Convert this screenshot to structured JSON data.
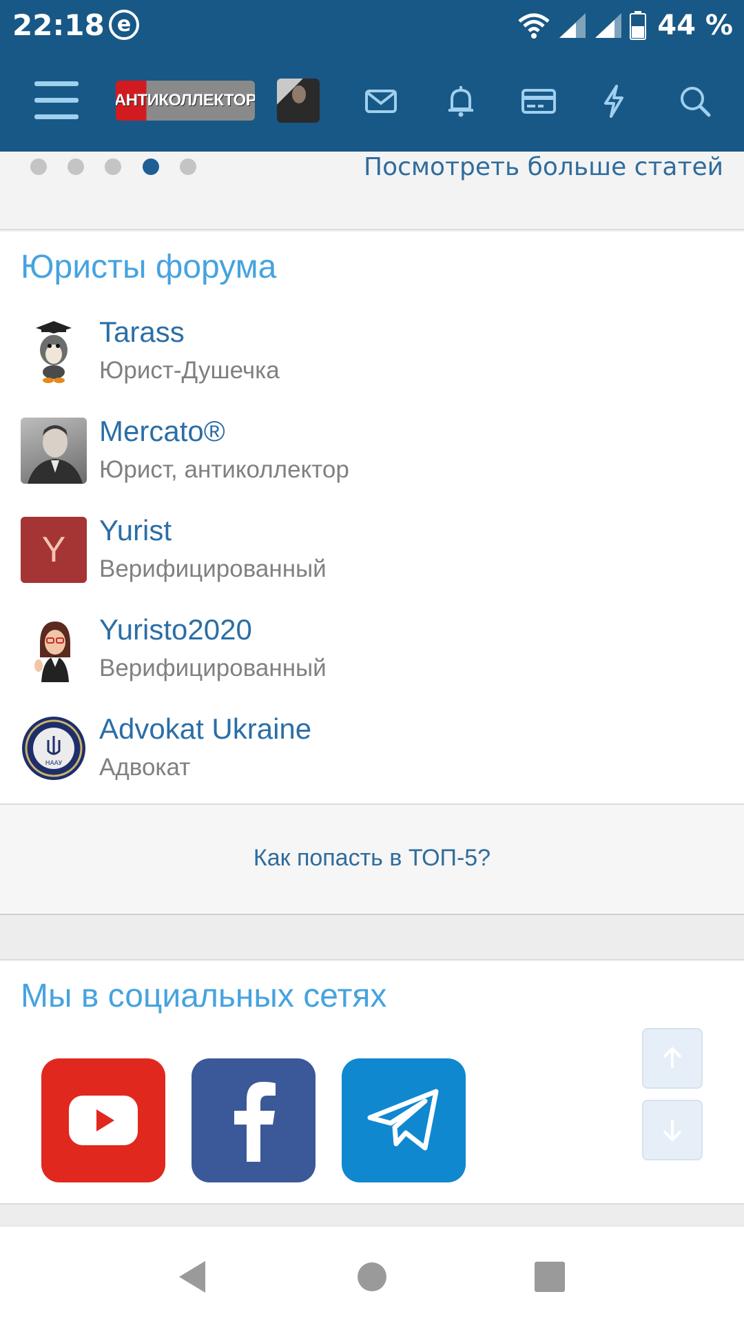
{
  "status_bar": {
    "time": "22:18",
    "app_indicator": "e",
    "battery_percent": "44 %",
    "icons": [
      "wifi-icon",
      "signal-icon",
      "signal-icon",
      "battery-icon"
    ]
  },
  "header": {
    "logo_text": "АНТИКОЛЛЕКТОР",
    "icons": [
      "menu-icon",
      "mail-icon",
      "bell-icon",
      "card-icon",
      "lightning-icon",
      "search-icon"
    ]
  },
  "carousel": {
    "dot_count": 5,
    "active_dot_index": 3,
    "more_link": "Посмотреть больше статей"
  },
  "lawyers": {
    "title": "Юристы форума",
    "items": [
      {
        "name": "Tarass",
        "role": "Юрист-Душечка"
      },
      {
        "name": "Mercato®",
        "role": "Юрист, антиколлектор"
      },
      {
        "name": "Yurist",
        "role": "Верифицированный",
        "avatar_letter": "Y"
      },
      {
        "name": "Yuristo2020",
        "role": "Верифицированный"
      },
      {
        "name": "Advokat Ukraine",
        "role": "Адвокат",
        "badge_text": "НААУ"
      }
    ],
    "top5_link": "Как попасть в ТОП-5?"
  },
  "social": {
    "title": "Мы в социальных сетях",
    "networks": [
      {
        "name": "youtube-icon",
        "color": "#e0281f"
      },
      {
        "name": "facebook-icon",
        "color": "#3b5998"
      },
      {
        "name": "telegram-icon",
        "color": "#0f88d0"
      }
    ]
  },
  "colors": {
    "header_bg": "#185886",
    "accent_link": "#2b6ea6",
    "section_title": "#46a3df",
    "active_dot": "#1d5f95"
  }
}
